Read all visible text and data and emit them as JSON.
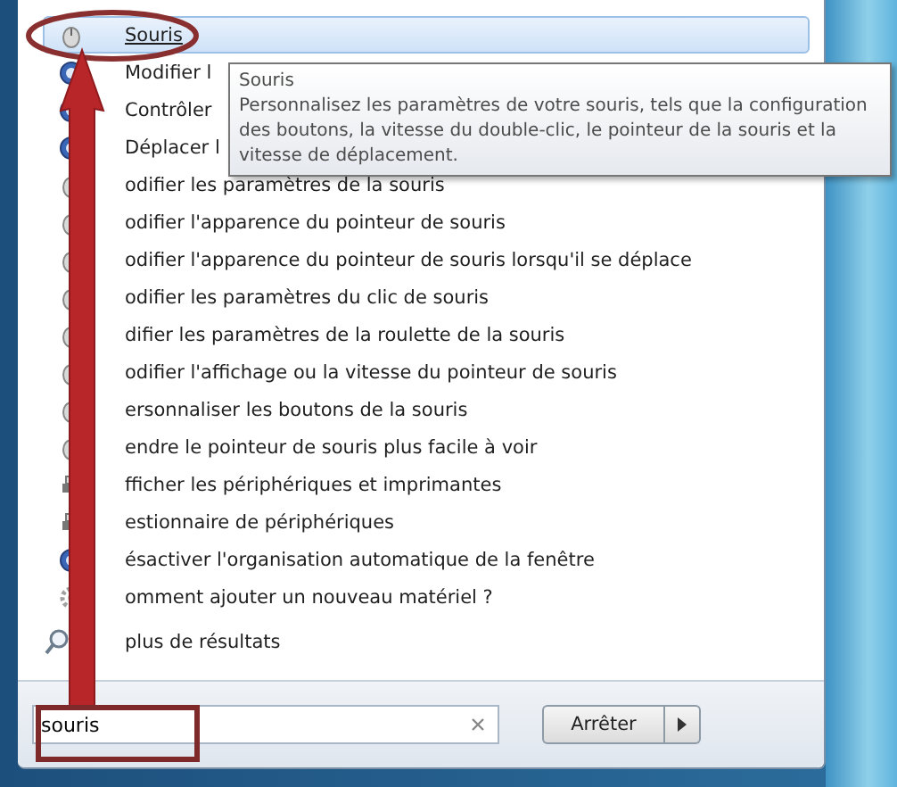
{
  "results": [
    {
      "label": "Souris",
      "kind": "mouse",
      "selected": true
    },
    {
      "label": "Modifier l",
      "kind": "panel",
      "selected": false
    },
    {
      "label": "Contrôler",
      "kind": "panel",
      "selected": false
    },
    {
      "label": "Déplacer l",
      "kind": "panel",
      "selected": false
    },
    {
      "label": "odifier les paramètres de la souris",
      "kind": "mouse",
      "selected": false
    },
    {
      "label": "odifier l'apparence du pointeur de souris",
      "kind": "mouse",
      "selected": false
    },
    {
      "label": "odifier l'apparence du pointeur de souris lorsqu'il se déplace",
      "kind": "mouse",
      "selected": false
    },
    {
      "label": "odifier les paramètres du clic de souris",
      "kind": "mouse",
      "selected": false
    },
    {
      "label": "difier les paramètres de la roulette de la souris",
      "kind": "mouse",
      "selected": false
    },
    {
      "label": "odifier l'affichage ou la vitesse du pointeur de souris",
      "kind": "mouse",
      "selected": false
    },
    {
      "label": "ersonnaliser les boutons de la souris",
      "kind": "mouse",
      "selected": false
    },
    {
      "label": "endre le pointeur de souris plus facile à voir",
      "kind": "mouse",
      "selected": false
    },
    {
      "label": "fficher les périphériques et imprimantes",
      "kind": "devices",
      "selected": false
    },
    {
      "label": "estionnaire de périphériques",
      "kind": "devices",
      "selected": false
    },
    {
      "label": "ésactiver l'organisation automatique de la fenêtre",
      "kind": "panel",
      "selected": false
    },
    {
      "label": "omment ajouter un nouveau matériel ?",
      "kind": "help",
      "selected": false
    }
  ],
  "tooltip": {
    "title": "Souris",
    "text": "Personnalisez les paramètres de votre souris, tels que la configuration des boutons, la vitesse du double-clic, le pointeur de la souris et la vitesse de déplacement."
  },
  "more_results": "plus de résultats",
  "search": {
    "value": "souris"
  },
  "stop_button": "Arrêter"
}
